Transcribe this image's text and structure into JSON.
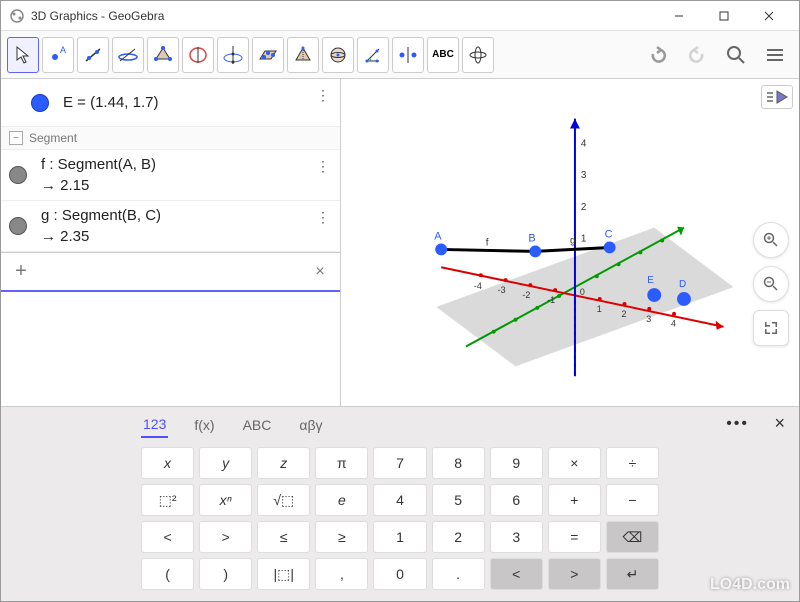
{
  "window": {
    "title": "3D Graphics - GeoGebra"
  },
  "algebra": {
    "pointE": "E = (1.44, 1.7)",
    "segmentHeader": "Segment",
    "f_label": "f : Segment(A, B)",
    "f_val": "→   2.15",
    "g_label": "g : Segment(B, C)",
    "g_val": "→   2.35",
    "plus": "+",
    "clear": "×"
  },
  "keyboard": {
    "tabs": {
      "t123": "123",
      "fx": "f(x)",
      "abc": "ABC",
      "greek": "αβγ"
    },
    "more": "•••",
    "close": "×",
    "rows": [
      [
        "x",
        "y",
        "z",
        "π",
        "7",
        "8",
        "9",
        "×",
        "÷"
      ],
      [
        "⬚²",
        "xⁿ",
        "√⬚",
        "e",
        "4",
        "5",
        "6",
        "+",
        "−"
      ],
      [
        "<",
        ">",
        "≤",
        "≥",
        "1",
        "2",
        "3",
        "=",
        "⌫"
      ],
      [
        "(",
        ")",
        "|⬚|",
        ",",
        "0",
        ".",
        "<",
        ">",
        "↵"
      ]
    ]
  },
  "watermark": "LO4D.com"
}
